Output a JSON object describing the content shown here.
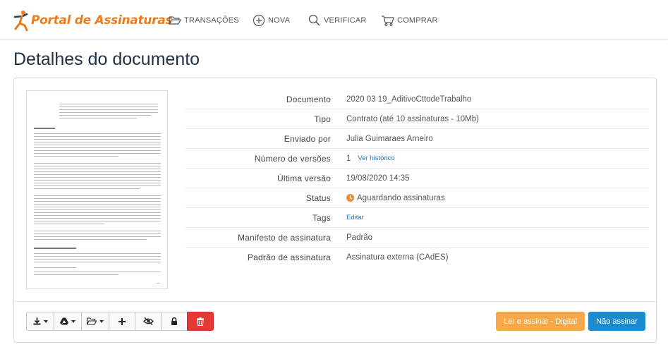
{
  "brand": {
    "name": "Portal de Assinaturas",
    "color": "#ef7a1a"
  },
  "nav": [
    {
      "label": "TRANSAÇÕES",
      "icon": "folder-open-icon"
    },
    {
      "label": "NOVA",
      "icon": "plus-circle-icon"
    },
    {
      "label": "VERIFICAR",
      "icon": "search-icon"
    },
    {
      "label": "COMPRAR",
      "icon": "cart-icon"
    }
  ],
  "page_title": "Detalhes do documento",
  "details": {
    "documento": {
      "label": "Documento",
      "value": "2020 03 19_AditivoCttodeTrabalho"
    },
    "tipo": {
      "label": "Tipo",
      "value": "Contrato (até 10 assinaturas - 10Mb)"
    },
    "enviado_por": {
      "label": "Enviado por",
      "value": "Julia Guimaraes Arneiro"
    },
    "versoes": {
      "label": "Número de versões",
      "value": "1",
      "link": "Ver histórico"
    },
    "ultima_versao": {
      "label": "Última versão",
      "value": "19/08/2020 14:35"
    },
    "status": {
      "label": "Status",
      "value": "Aguardando assinaturas",
      "icon": "clock-icon",
      "color": "#ef8c2a"
    },
    "tags": {
      "label": "Tags",
      "link": "Editar"
    },
    "manifesto": {
      "label": "Manifesto de assinatura",
      "value": "Padrão"
    },
    "padrao": {
      "label": "Padrão de assinatura",
      "value": "Assinatura externa (CAdES)"
    }
  },
  "toolbar": {
    "icons": [
      "download-icon",
      "google-drive-icon",
      "folder-icon",
      "plus-icon",
      "eye-slash-icon",
      "lock-icon",
      "trash-icon"
    ],
    "danger_color": "#e53935"
  },
  "actions": {
    "read_sign": "Ler e assinar - Digital",
    "read_sign_color": "#f7a84b",
    "no_sign": "Não assinar",
    "no_sign_color": "#1b8bd0"
  }
}
